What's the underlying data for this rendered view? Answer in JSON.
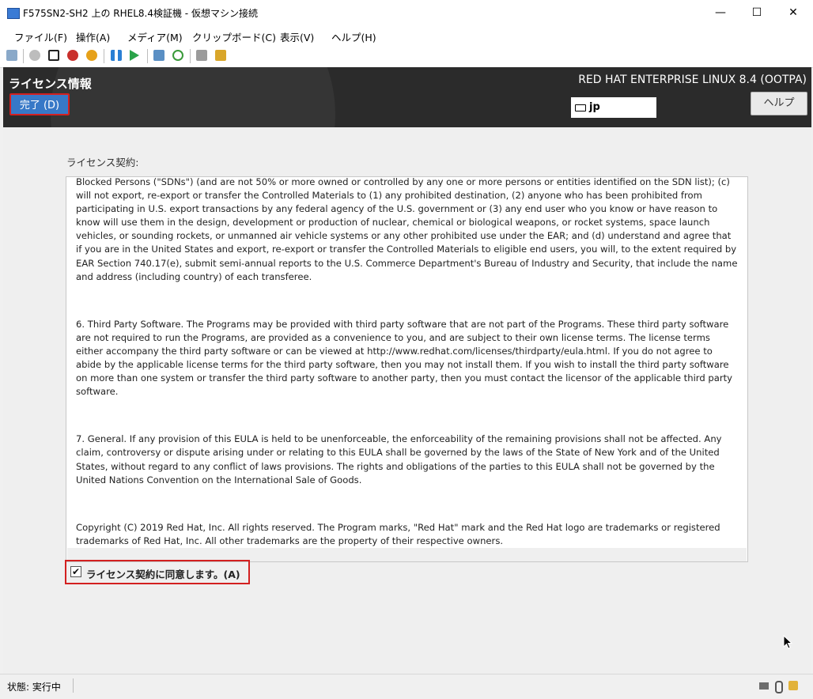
{
  "window": {
    "title": "F575SN2-SH2 上の RHEL8.4検証機 - 仮想マシン接続",
    "minimize": "—",
    "maximize": "☐",
    "close": "✕"
  },
  "menu": [
    "ファイル(F)",
    "操作(A)",
    "メディア(M)",
    "クリップボード(C)",
    "表示(V)",
    "ヘルプ(H)"
  ],
  "toolbar_icons": [
    "ctrl-alt-del-icon",
    "start-icon",
    "turn-off-icon",
    "shutdown-icon",
    "power-icon",
    "pause-icon",
    "resume-icon",
    "checkpoint-icon",
    "revert-icon",
    "enhanced-session-icon",
    "share-icon"
  ],
  "header": {
    "spoke_title": "ライセンス情報",
    "done_label": "完了 (D)",
    "product": "RED HAT ENTERPRISE LINUX 8.4 (OOTPA)",
    "keyboard_layout": "jp",
    "help_label": "ヘルプ"
  },
  "license": {
    "label": "ライセンス契約:",
    "paragraphs": [
      "Blocked Persons (\"SDNs\") (and are not 50% or more owned or controlled by any one or more persons or entities identified on the SDN list); (c) will not export, re-export or transfer the Controlled Materials to (1) any prohibited destination, (2) anyone who has been prohibited from participating in U.S. export transactions by any federal agency of the U.S. government or (3) any end user who you know or have reason to know will use them in the design, development or production of nuclear, chemical or biological weapons, or rocket systems, space launch vehicles, or sounding rockets, or unmanned air vehicle systems or any other prohibited use under the EAR; and (d) understand and agree that if you are in the United States and export, re-export or transfer the Controlled Materials to eligible end users, you will, to the extent required by EAR Section 740.17(e), submit semi-annual reports to the U.S. Commerce Department's Bureau of Industry and Security, that include the name and address (including country) of each transferee.",
      " 6. Third Party Software. The Programs may be provided with third party software that are not part of the Programs. These third party software are not required to run the Programs, are provided as a convenience to you, and are subject to their own license terms. The license terms either accompany the third party software or can be viewed at http://www.redhat.com/licenses/thirdparty/eula.html. If you do not agree to abide by the applicable license terms for the third party software, then you may not install them. If you wish to install the third party software on more than one system or transfer the third party software to another party, then you must contact the licensor of the applicable third party software.",
      " 7. General. If any provision of this EULA is held to be unenforceable, the enforceability of the remaining provisions shall not be affected. Any claim, controversy or dispute arising under or relating to this EULA shall be governed by the laws of the State of New York and of the United States, without regard to any conflict of laws provisions. The rights and obligations of the parties to this EULA shall not be governed by the United Nations Convention on the International Sale of Goods.",
      " Copyright (C) 2019 Red Hat, Inc. All rights reserved. The Program marks, \"Red Hat\" mark and the Red Hat logo are trademarks or registered trademarks of Red Hat, Inc. All other trademarks are the property of their respective owners."
    ],
    "agree_label": "ライセンス契約に同意します。(A)",
    "agree_checked": true
  },
  "status": {
    "text": "状態: 実行中"
  }
}
